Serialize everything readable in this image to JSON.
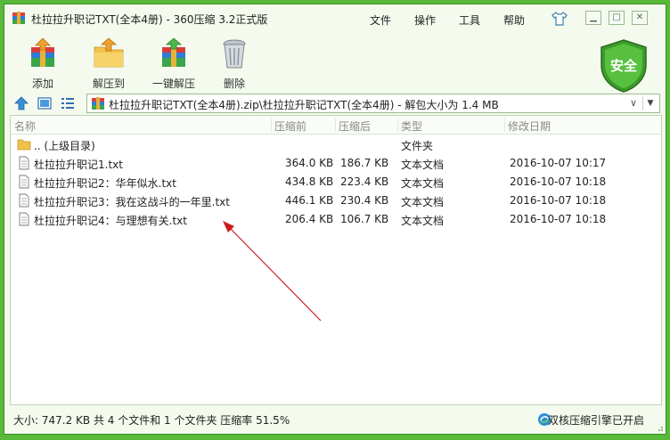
{
  "window": {
    "title": "杜拉拉升职记TXT(全本4册) - 360压缩 3.2正式版",
    "menu": [
      "文件",
      "操作",
      "工具",
      "帮助"
    ]
  },
  "toolbar": {
    "add": "添加",
    "extract_to": "解压到",
    "one_click_extract": "一键解压",
    "delete": "删除",
    "security": "安全"
  },
  "address": {
    "path": "杜拉拉升职记TXT(全本4册).zip\\杜拉拉升职记TXT(全本4册) - 解包大小为 1.4 MB"
  },
  "columns": [
    "名称",
    "压缩前",
    "压缩后",
    "类型",
    "修改日期"
  ],
  "files": [
    {
      "name": ".. (上级目录)",
      "size": "",
      "packed": "",
      "type": "文件夹",
      "date": "",
      "icon": "folder-icon"
    },
    {
      "name": "杜拉拉升职记1.txt",
      "size": "364.0 KB",
      "packed": "186.7 KB",
      "type": "文本文档",
      "date": "2016-10-07 10:17",
      "icon": "text-file-icon"
    },
    {
      "name": "杜拉拉升职记2：华年似水.txt",
      "size": "434.8 KB",
      "packed": "223.4 KB",
      "type": "文本文档",
      "date": "2016-10-07 10:18",
      "icon": "text-file-icon"
    },
    {
      "name": "杜拉拉升职记3：我在这战斗的一年里.txt",
      "size": "446.1 KB",
      "packed": "230.4 KB",
      "type": "文本文档",
      "date": "2016-10-07 10:18",
      "icon": "text-file-icon"
    },
    {
      "name": "杜拉拉升职记4：与理想有关.txt",
      "size": "206.4 KB",
      "packed": "106.7 KB",
      "type": "文本文档",
      "date": "2016-10-07 10:18",
      "icon": "text-file-icon"
    }
  ],
  "status": {
    "summary": "大小: 747.2 KB 共 4 个文件和 1 个文件夹 压缩率 51.5%",
    "engine": "双核压缩引擎已开启"
  },
  "colors": {
    "frame_green": "#58b93a",
    "window_bg": "#f4faee",
    "arrow_red": "#cc1a1a"
  }
}
